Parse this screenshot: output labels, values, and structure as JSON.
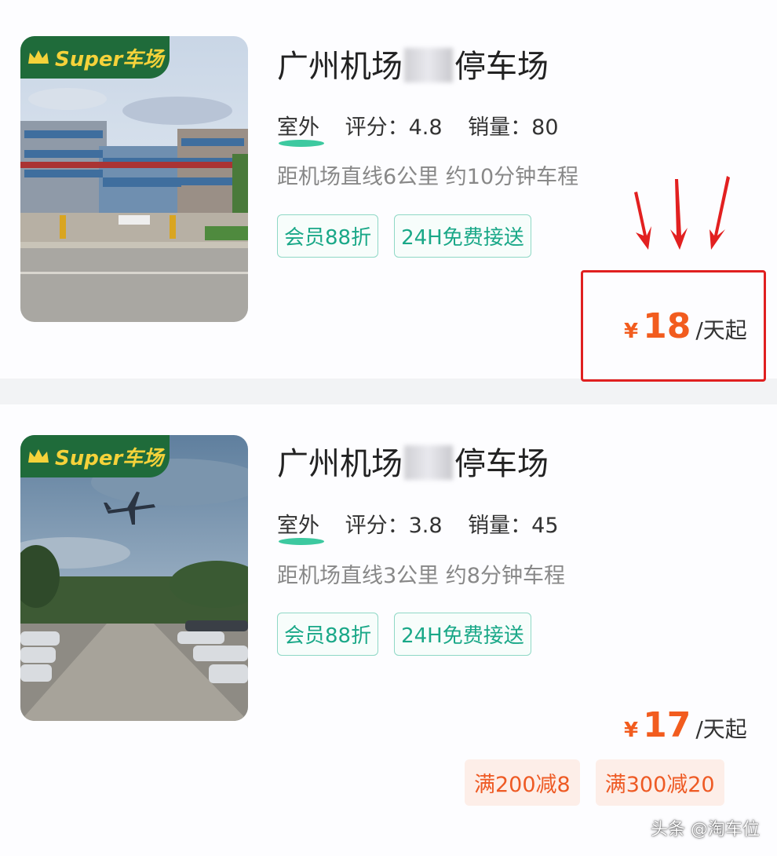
{
  "listings": [
    {
      "badge": "Super车场",
      "title_prefix": "广州机场",
      "title_suffix": "停车场",
      "type": "室外",
      "rating_label": "评分：",
      "rating": "4.8",
      "sales_label": "销量：",
      "sales": "80",
      "distance": "距机场直线6公里 约10分钟车程",
      "tags": [
        "会员88折",
        "24H免费接送"
      ],
      "currency": "¥",
      "price": "18",
      "price_unit": "/天起"
    },
    {
      "badge": "Super车场",
      "title_prefix": "广州机场",
      "title_suffix": "停车场",
      "type": "室外",
      "rating_label": "评分：",
      "rating": "3.8",
      "sales_label": "销量：",
      "sales": "45",
      "distance": "距机场直线3公里 约8分钟车程",
      "tags": [
        "会员88折",
        "24H免费接送"
      ],
      "currency": "¥",
      "price": "17",
      "price_unit": "/天起",
      "promos": [
        "满200减8",
        "满300减20"
      ]
    }
  ],
  "watermark": "头条 @淘车位",
  "colors": {
    "accent_teal": "#1aa888",
    "price_orange": "#f25c1e",
    "annotation_red": "#e02020",
    "badge_green": "#1f6b3a",
    "badge_text": "#f5d23a"
  },
  "icons": [
    "crown-icon",
    "down-arrow-icon"
  ]
}
